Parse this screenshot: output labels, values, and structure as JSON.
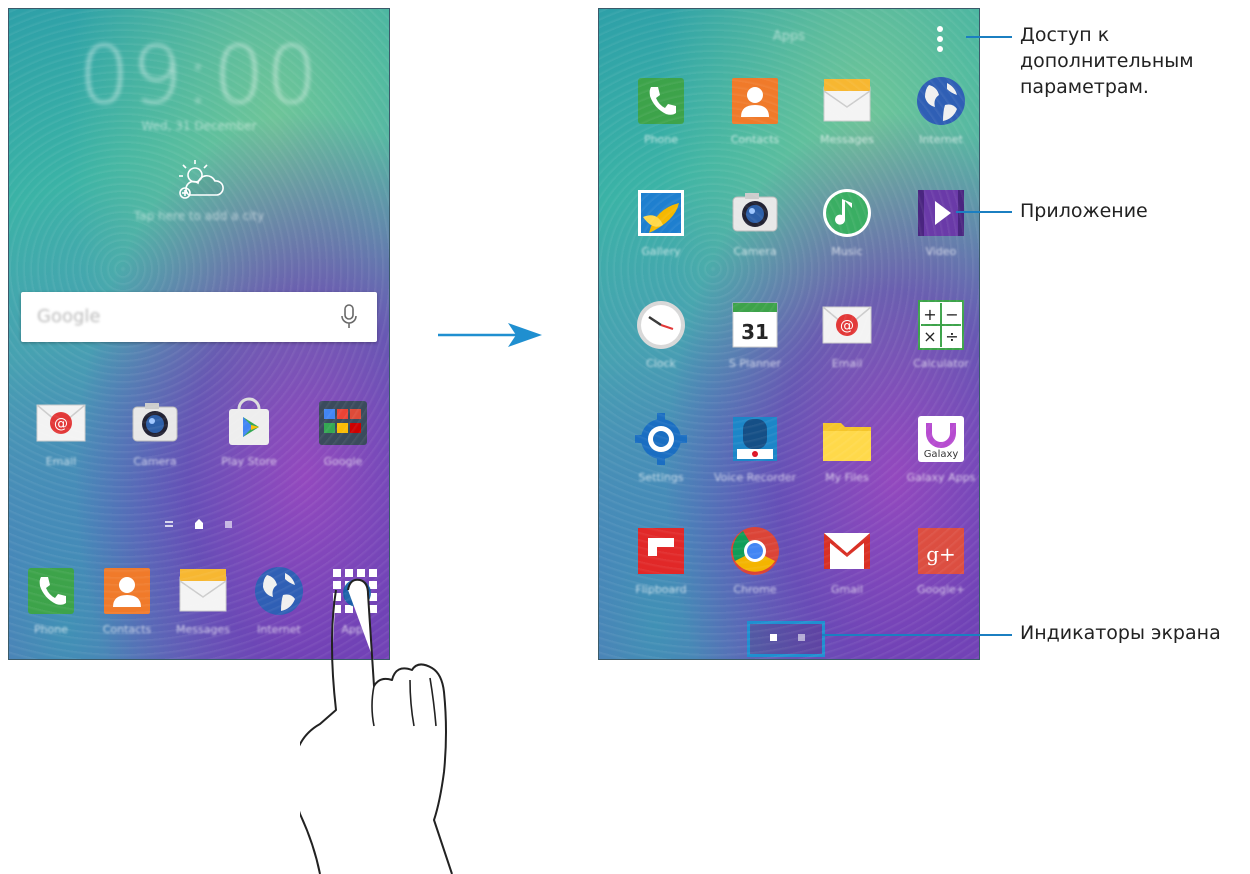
{
  "home": {
    "clock": "09:00",
    "date": "Wed, 31 December",
    "weather_tip": "Tap here to add a city",
    "search": {
      "logo": "Google"
    },
    "icons": [
      {
        "label": "Email",
        "icon": "email-icon"
      },
      {
        "label": "Camera",
        "icon": "camera-icon"
      },
      {
        "label": "Play Store",
        "icon": "play-store-icon"
      },
      {
        "label": "Google",
        "icon": "google-folder-icon"
      }
    ],
    "dock": [
      {
        "label": "Phone",
        "icon": "phone-icon"
      },
      {
        "label": "Contacts",
        "icon": "contacts-icon"
      },
      {
        "label": "Messages",
        "icon": "messages-icon"
      },
      {
        "label": "Internet",
        "icon": "internet-icon"
      },
      {
        "label": "Apps",
        "icon": "apps-grid-icon"
      }
    ]
  },
  "apps": {
    "title": "Apps",
    "grid": [
      {
        "label": "Phone",
        "icon": "phone-icon"
      },
      {
        "label": "Contacts",
        "icon": "contacts-icon"
      },
      {
        "label": "Messages",
        "icon": "messages-icon"
      },
      {
        "label": "Internet",
        "icon": "internet-icon"
      },
      {
        "label": "Gallery",
        "icon": "gallery-icon"
      },
      {
        "label": "Camera",
        "icon": "camera-icon"
      },
      {
        "label": "Music",
        "icon": "music-icon"
      },
      {
        "label": "Video",
        "icon": "video-icon"
      },
      {
        "label": "Clock",
        "icon": "clock-icon"
      },
      {
        "label": "S Planner",
        "icon": "calendar-icon",
        "text": "31"
      },
      {
        "label": "Email",
        "icon": "email-icon"
      },
      {
        "label": "Calculator",
        "icon": "calculator-icon"
      },
      {
        "label": "Settings",
        "icon": "settings-icon"
      },
      {
        "label": "Voice Recorder",
        "icon": "voice-recorder-icon"
      },
      {
        "label": "My Files",
        "icon": "folder-icon"
      },
      {
        "label": "Galaxy Apps",
        "icon": "galaxy-apps-icon",
        "text": "Galaxy"
      },
      {
        "label": "Flipboard",
        "icon": "flipboard-icon"
      },
      {
        "label": "Chrome",
        "icon": "chrome-icon"
      },
      {
        "label": "Gmail",
        "icon": "gmail-icon"
      },
      {
        "label": "Google+",
        "icon": "google-plus-icon",
        "text": "g+"
      }
    ]
  },
  "callouts": {
    "more_options": "Доступ к дополнительным параметрам.",
    "app": "Приложение",
    "indicators": "Индикаторы экрана"
  },
  "colors": {
    "accent": "#1f8fd0",
    "callout_line": "#1b7fc1"
  }
}
